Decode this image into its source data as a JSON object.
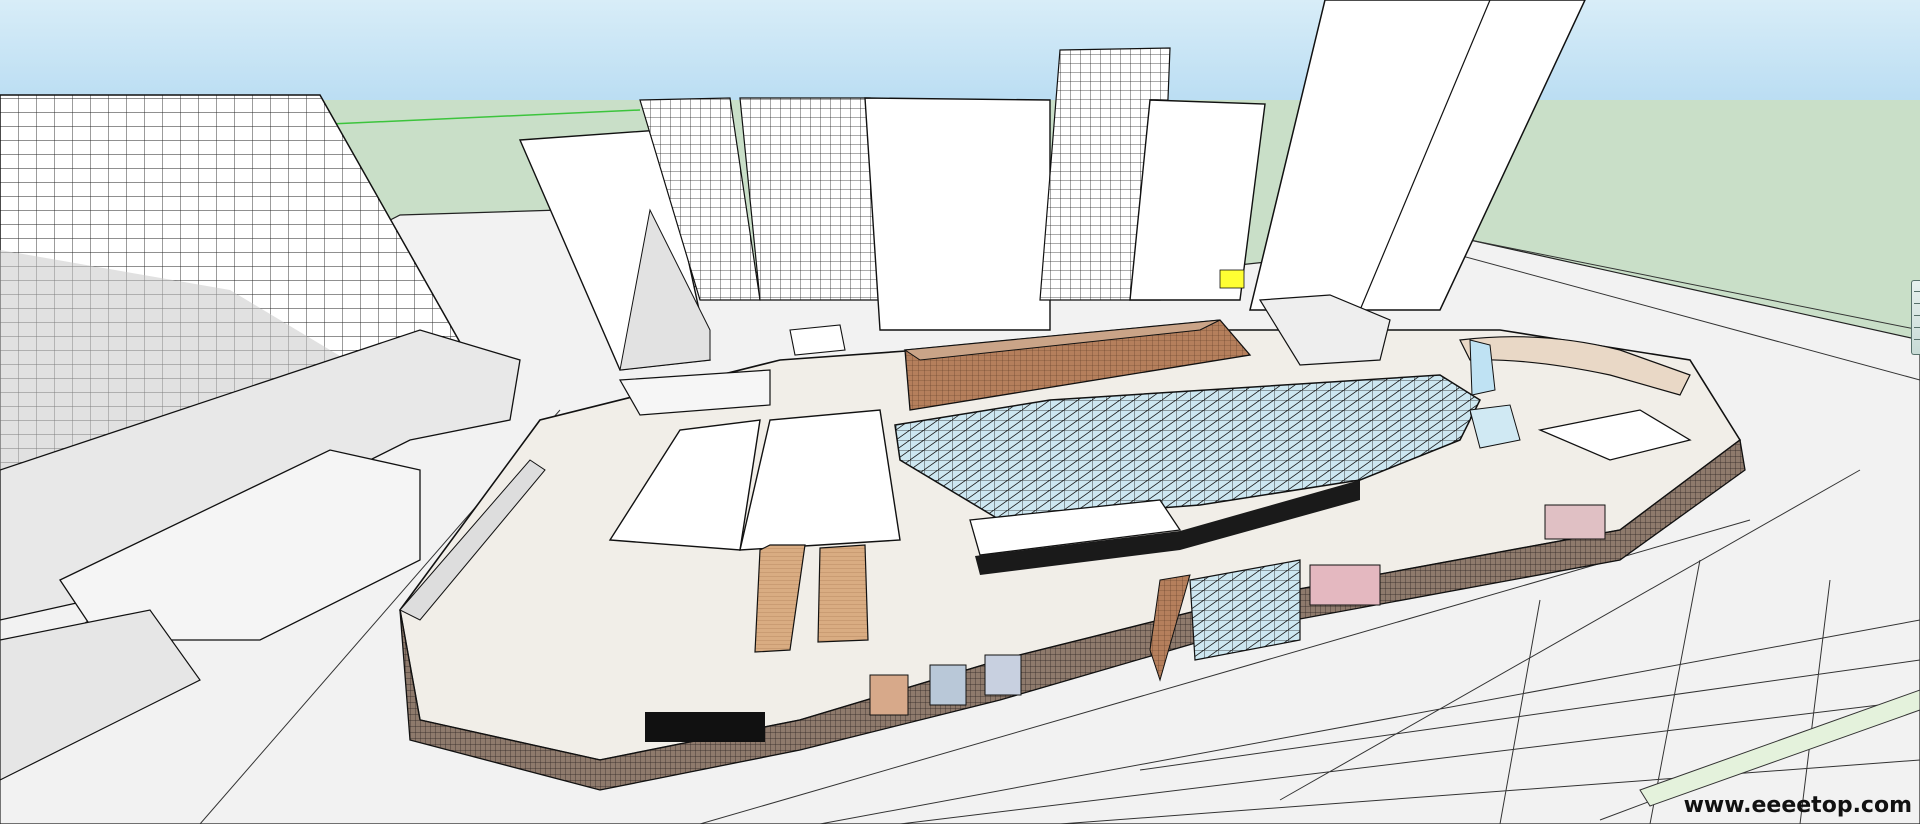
{
  "window": {
    "watermark": "www.eeeetop.com"
  },
  "colors": {
    "sky_top": "#d8edf8",
    "sky_bottom": "#b8dcf2",
    "ground": "#c9dfc8",
    "road": "#f2f2f2",
    "building": "#ffffff",
    "shadow": "#d6d6d6",
    "outline": "#141414",
    "brick": "#b57f5c",
    "wood": "#d9ac82",
    "glass": "#bfe2f3",
    "axis_green": "#3cc43c",
    "highlight_yellow": "#ffff33",
    "scale_bar": "#c8dbd6"
  },
  "icons": {
    "scale_bar": "vertical-slider-handle"
  }
}
